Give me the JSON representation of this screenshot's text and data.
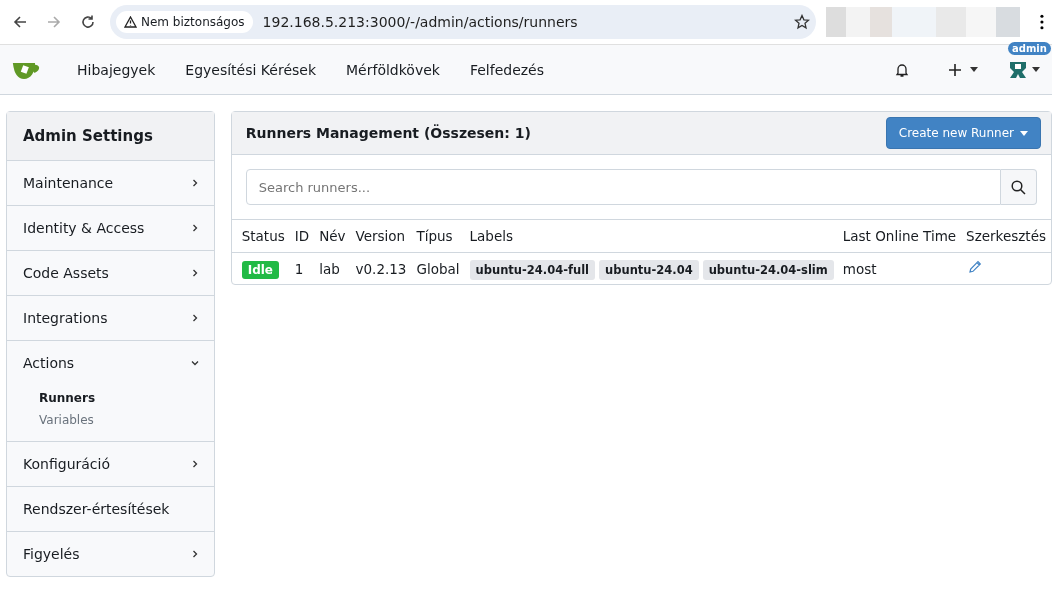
{
  "browser": {
    "security_label": "Nem biztonságos",
    "url": "192.168.5.213:3000/-/admin/actions/runners"
  },
  "navbar": {
    "links": [
      "Hibajegyek",
      "Egyesítési Kérések",
      "Mérföldkövek",
      "Felfedezés"
    ],
    "user_badge": "admin"
  },
  "sidebar": {
    "title": "Admin Settings",
    "items": [
      {
        "label": "Maintenance",
        "kind": "group",
        "expanded": false
      },
      {
        "label": "Identity & Access",
        "kind": "group",
        "expanded": false
      },
      {
        "label": "Code Assets",
        "kind": "group",
        "expanded": false
      },
      {
        "label": "Integrations",
        "kind": "group",
        "expanded": false
      },
      {
        "label": "Actions",
        "kind": "group",
        "expanded": true,
        "children": [
          {
            "label": "Runners",
            "selected": true
          },
          {
            "label": "Variables",
            "selected": false
          }
        ]
      },
      {
        "label": "Konfiguráció",
        "kind": "group",
        "expanded": false
      },
      {
        "label": "Rendszer-értesítések",
        "kind": "link"
      },
      {
        "label": "Figyelés",
        "kind": "group",
        "expanded": false
      }
    ]
  },
  "panel": {
    "title": "Runners Management (Összesen: 1)",
    "create_button": "Create new Runner",
    "search": {
      "placeholder": "Search runners..."
    },
    "table": {
      "columns": [
        "Status",
        "ID",
        "Név",
        "Version",
        "Típus",
        "Labels",
        "Last Online Time",
        "Szerkesztés"
      ],
      "rows": [
        {
          "status": "Idle",
          "id": "1",
          "name": "lab",
          "version": "v0.2.13",
          "type": "Global",
          "labels": [
            "ubuntu-24.04-full",
            "ubuntu-24.04",
            "ubuntu-24.04-slim"
          ],
          "last_online": "most"
        }
      ]
    }
  }
}
